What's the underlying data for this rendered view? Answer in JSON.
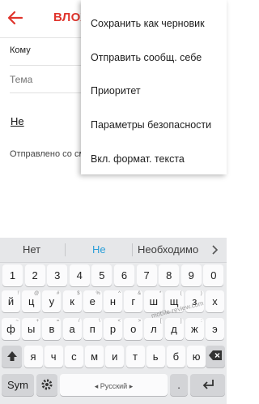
{
  "compose": {
    "title": "ВЛОЖ",
    "to_label": "Кому",
    "subject_placeholder": "Тема",
    "body_text": "Не",
    "signature": "Отправлено со см"
  },
  "menu": {
    "items": [
      "Сохранить как черновик",
      "Отправить сообщ. себе",
      "Приоритет",
      "Параметры безопасности",
      "Вкл. формат. текста"
    ]
  },
  "keyboard": {
    "suggestions": [
      "Нет",
      "Не",
      "Необходимо"
    ],
    "accent_color": "#2a9ed8",
    "numbers": [
      "1",
      "2",
      "3",
      "4",
      "5",
      "6",
      "7",
      "8",
      "9",
      "0"
    ],
    "row1": [
      "й",
      "ц",
      "у",
      "к",
      "е",
      "н",
      "г",
      "ш",
      "щ",
      "з",
      "х"
    ],
    "row2": [
      "ф",
      "ы",
      "в",
      "а",
      "п",
      "р",
      "о",
      "л",
      "д",
      "ж",
      "э"
    ],
    "row3": [
      "я",
      "ч",
      "с",
      "м",
      "и",
      "т",
      "ь",
      "б",
      "ю"
    ],
    "hints1": [
      "!",
      "@",
      "#",
      "$",
      "%",
      "^",
      "&",
      "*",
      "(",
      ")",
      ""
    ],
    "hints2": [
      "~",
      "+",
      "=",
      "/",
      "\\",
      "<",
      ">",
      "[",
      "]",
      ":",
      ""
    ],
    "sym_label": "Sym",
    "space_label": "Русский",
    "space_left_arrow": "◂",
    "space_right_arrow": "▸"
  },
  "watermark": "mobile-review.com"
}
